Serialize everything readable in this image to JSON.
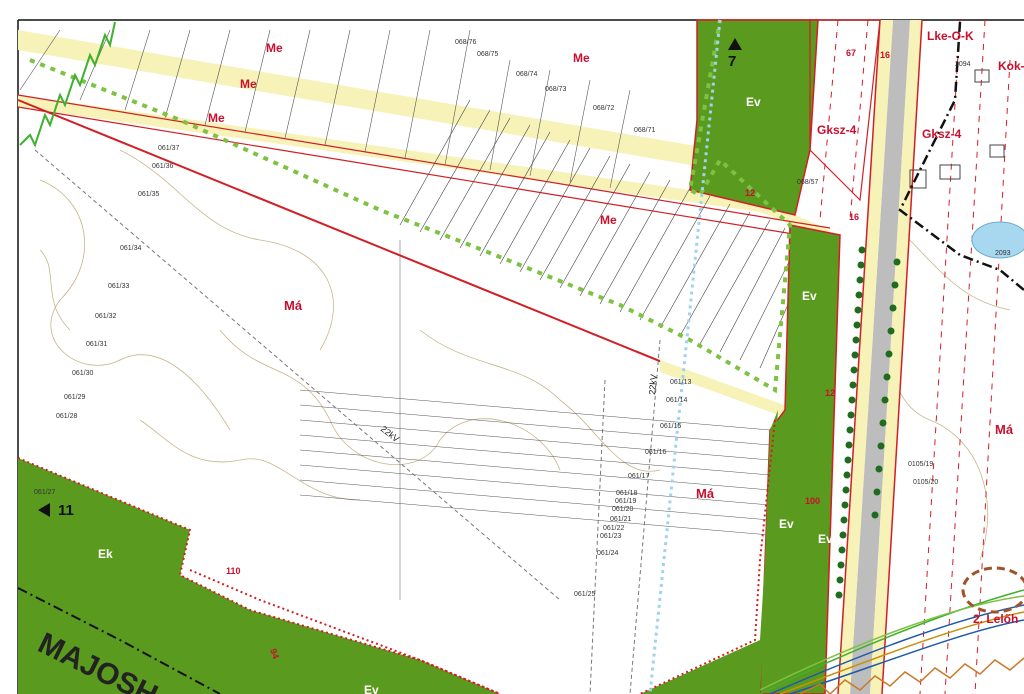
{
  "zones": {
    "me": "Me",
    "ma": "Má",
    "ev": "Ev",
    "ek": "Ek",
    "gksz4": "Gksz-4",
    "lke_o_k": "Lke-O-K",
    "kok": "Kok-"
  },
  "sheet_refs": {
    "north": "7",
    "west": "11"
  },
  "line_labels": {
    "kv22": "22kV",
    "kv22_vertical": "22kV"
  },
  "site_label": "2. Lelőh",
  "road_title": "MAJOSH",
  "elevations": {
    "e110": "110",
    "e100": "100",
    "e94": "94",
    "e12a": "12",
    "e12b": "12",
    "e16a": "16",
    "e16b": "16",
    "e67": "67"
  },
  "parcels": {
    "p061_35": "061/35",
    "p061_34": "061/34",
    "p061_33": "061/33",
    "p061_32": "061/32",
    "p061_31": "061/31",
    "p061_30": "061/30",
    "p061_29": "061/29",
    "p061_28": "061/28",
    "p061_27": "061/27",
    "p061_36": "061/36",
    "p061_37": "061/37",
    "p061_13": "061/13",
    "p061_14": "061/14",
    "p061_15": "061/15",
    "p061_16": "061/16",
    "p061_17": "061/17",
    "p061_18": "061/18",
    "p061_19": "061/19",
    "p061_20": "061/20",
    "p061_21": "061/21",
    "p061_22": "061/22",
    "p061_23": "061/23",
    "p061_24": "061/24",
    "p061_25": "061/25",
    "p068_74": "068/74",
    "p068_73": "068/73",
    "p068_72": "068/72",
    "p068_71": "068/71",
    "p068_75": "068/75",
    "p068_76": "068/76",
    "p068_57": "068/57",
    "p2093": "2093",
    "p2094": "2094",
    "p0105_19": "0105/19",
    "p0105_20": "0105/20"
  },
  "colors": {
    "green_zone": "#5a9a1e",
    "red_boundary": "#d21f26",
    "road_yellow": "#f6f2b8",
    "road_gray": "#bdbdbd",
    "contour": "#b39c6a"
  }
}
